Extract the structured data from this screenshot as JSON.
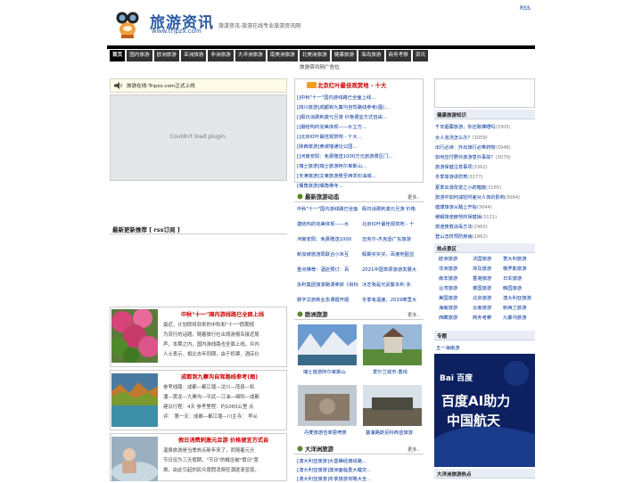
{
  "header": {
    "logo_text": "旅游资讯",
    "logo_url": "www.tripzx.com",
    "slogan": "旅游资讯-旅游在线专业旅游资讯网",
    "rss": "RSS"
  },
  "nav": [
    "首页",
    "国内旅游",
    "欧洲旅游",
    "亚洲旅游",
    "非洲旅游",
    "大洋洲旅游",
    "南美洲旅游",
    "北美洲旅游",
    "健康旅游",
    "海岛旅游",
    "商务考察",
    "资讯"
  ],
  "ad_line": "旅游资讯网广告位",
  "notice": "旅游在线-Tripzx.com正式上线",
  "plugin": "Couldn't load plugin.",
  "recommend": "最新更新推荐 [ rss订阅 ]",
  "features": [
    {
      "title": "中秋\"十一\"国内游线路已全面上线",
      "text": [
        "最近，计划即将到来的中秋和\"十一\"假期规",
        "为流行的话题。随着旅行社出境游报名接近尾",
        "声，本期之内，国内游线路也全面上线，众内",
        "人士表示，相比去年同期，由于机票、酒店价"
      ]
    },
    {
      "title": "成都到九寨沟自驾路线参考(图)",
      "text": [
        "参考线路：成都—都江堰—汶川—茂县—松",
        "潘—黄龙—九寨沟—平武—江油—绵阳—成都",
        "建议行程：4天 参考里程：约1065公里 点",
        "评： 第一天：成都—都江堰—川主寺： 早从"
      ]
    },
    {
      "title": "假日消费刺激元旦游 价格便宜方式自",
      "text": [
        "温泉旅游是当季热点新年来了，而随着元旦",
        "节日仅为三天假期，\"节日\"的概念被\"假日\"置",
        "换，由此引起的民众度假消费狂潮逐渐显现。"
      ]
    }
  ],
  "mid_top": {
    "title": "北京红叶最佳观赏地 - 十大",
    "links": [
      "[]中秋\"十一\"国内游线路已全面上线...",
      "[四川旅游]成都到九寨沟自驾路线参考(图)...",
      "[]假日消费刺激元旦游 价格便宜方式自由...",
      "[]摄结构的完美体现——水立方...",
      "[]北京红叶最佳观赏地 - 十大...",
      "[陕西旅游]黄城墙通址公园...",
      "[]河南安阳：免费赠送1000万元旅游景区门...",
      "[瑞士旅游]瑞士旅游阿尔卑斯山...",
      "[天津旅游]文莱旅游景至西郊石油城...",
      "[嘴角旅游]嘴角佛寺..."
    ]
  },
  "latest": {
    "title": "最新旅游动态",
    "more": "更多..",
    "items": [
      [
        "中秋\"十一\"国内游线路已全面",
        "假日消费刺激元旦游 价格"
      ],
      [
        "建结构的完美体现——水",
        "北京红叶最佳观赏地 - 十"
      ],
      [
        "河南安阳：免费赠送1000",
        "迈克尔-杰克逊广东旅游"
      ],
      [
        "新加坡旅游局联合小米互",
        "假期买买买，百度地图显"
      ],
      [
        "重点推荐：酒店预订：百",
        "2021中国草原旅游发展大"
      ],
      [
        "永利集团旅游路漫荣获《目标",
        "冰芝我是光武繁永利 永"
      ],
      [
        "数字文旅新业态课题开题",
        "冬季有温度，2019寒里大"
      ]
    ]
  },
  "europe": {
    "title": "欧洲旅游",
    "more": "更多..",
    "photos": [
      {
        "caption": "瑞士旅游阿尔卑斯山"
      },
      {
        "caption": "爱尔兰城市-香侬"
      },
      {
        "caption": "丹麦旅游吉菲恩喷泉"
      },
      {
        "caption": "塞浦路斯尼科西亚旅游"
      }
    ]
  },
  "oceania": {
    "title": "大洋洲旅游",
    "more": "更多..",
    "links": [
      "[澳大利亚旅游]大堡礁经典线路...",
      "[澳大利亚旅游]澳洲面临重大蝗灾...",
      "[澳大利亚旅游]冬季旅游攻略大全..."
    ]
  },
  "right": {
    "health_title": "健康旅游知识",
    "health": [
      {
        "t": "千年烟寨旅游，你还敢裸晒吗",
        "c": "(3305)"
      },
      {
        "t": "女人泡汤怎么办？",
        "c": "(3059)"
      },
      {
        "t": "出行必读：外出旅行必带药物",
        "c": "(3948)"
      },
      {
        "t": "如何应付野外旅游意外事故？",
        "c": "(3079)"
      },
      {
        "t": "旅游保健注意事项",
        "c": "(3362)"
      },
      {
        "t": "冬季旅游讲防寒",
        "c": "(3277)"
      },
      {
        "t": "夏季出游改变之小药箱篇",
        "c": "(3165)"
      },
      {
        "t": "旅游中如何减轻时差对人体的影响",
        "c": "(3064)"
      },
      {
        "t": "健康旅游从踏上开始",
        "c": "(3044)"
      },
      {
        "t": "缓解旅途疲劳的保健操",
        "c": "(3121)"
      },
      {
        "t": "旅途搜救消毒方法",
        "c": "(2960)"
      },
      {
        "t": "登山怎样预防疾病",
        "c": "(2862)"
      }
    ],
    "hot_title": "热点景区",
    "hot": [
      [
        "欧洲旅游",
        "法国旅游",
        "意大利旅游"
      ],
      [
        "非洲旅游",
        "埃及旅游",
        "俄罗斯旅游"
      ],
      [
        "南非旅游",
        "香港旅游",
        "日本旅游"
      ],
      [
        "台湾旅游",
        "泰国旅游",
        "韩国旅游"
      ],
      [
        "美国旅游",
        "北京旅游",
        "澳大利亚旅游"
      ],
      [
        "海南旅游",
        "云南旅游",
        "新西兰旅游"
      ],
      [
        "西藏旅游",
        "商务考察",
        "九寨沟旅游"
      ]
    ],
    "topic_title": "专题",
    "topic_link": "五一海南游",
    "banner_logo": "Bai 百度",
    "banner_line1": "百度AI助力",
    "banner_line2": "中国航天",
    "bottom_title": "大洋洲旅游热点"
  }
}
